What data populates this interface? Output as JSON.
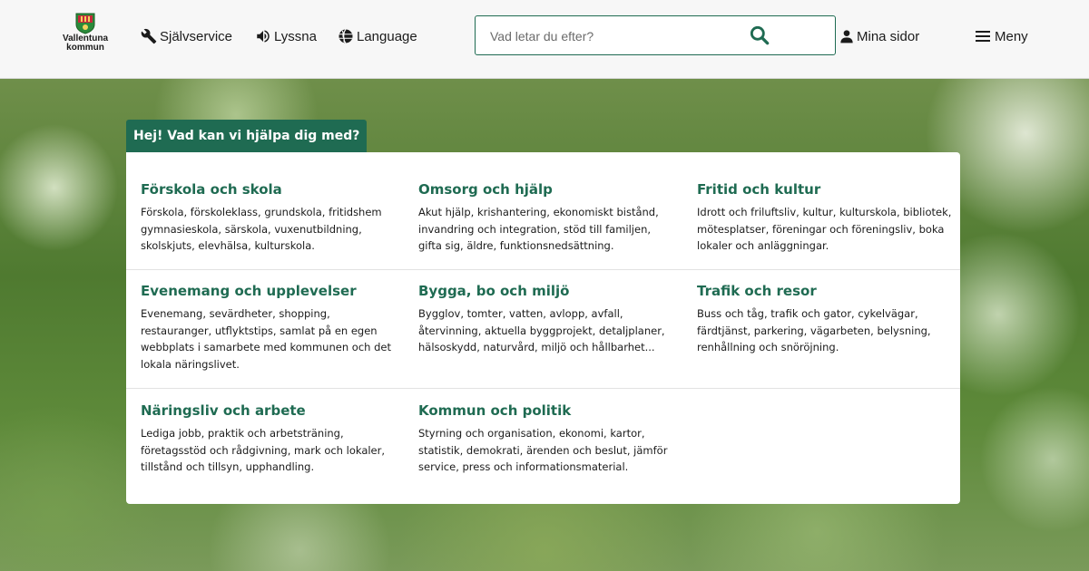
{
  "header": {
    "logo_text_line1": "Vallentuna",
    "logo_text_line2": "kommun",
    "selfservice_label": "Självservice",
    "listen_label": "Lyssna",
    "language_label": "Language",
    "search_placeholder": "Vad letar du efter?",
    "my_pages_label": "Mina sidor",
    "menu_label": "Meny",
    "icons": {
      "selfservice": "wrench-icon",
      "listen": "speaker-icon",
      "language": "globe-icon",
      "search": "search-icon",
      "my_pages": "user-icon",
      "menu": "hamburger-menu-icon"
    }
  },
  "main": {
    "greeting": "Hej! Vad kan vi hjälpa dig med?",
    "categories": [
      {
        "title": "Förskola och skola",
        "description": "Förskola, förskoleklass, grundskola, fritidshem gymnasieskola, särskola, vuxenutbildning, skolskjuts, elevhälsa, kulturskola."
      },
      {
        "title": "Omsorg och hjälp",
        "description": "Akut hjälp, krishantering, ekonomiskt bistånd, invandring och integration, stöd till familjen, gifta sig, äldre, funktionsnedsättning."
      },
      {
        "title": "Fritid och kultur",
        "description": "Idrott och friluftsliv, kultur, kulturskola, bibliotek, mötesplatser, föreningar och föreningsliv, boka lokaler och anläggningar."
      },
      {
        "title": "Evenemang och upplevelser",
        "description": "Evenemang, sevärdheter, shopping, restauranger, utflyktstips, samlat på en egen webbplats i samarbete med kommunen och det lokala näringslivet."
      },
      {
        "title": "Bygga, bo och miljö",
        "description": "Bygglov, tomter, vatten, avlopp, avfall, återvinning, aktuella byggprojekt, detaljplaner, hälsoskydd, naturvård, miljö och hållbarhet..."
      },
      {
        "title": "Trafik och resor",
        "description": "Buss och tåg, trafik och gator, cykelvägar, färdtjänst, parkering, vägarbeten, belysning, renhållning och snöröjning."
      },
      {
        "title": "Näringsliv och arbete",
        "description": "Lediga jobb, praktik och arbetsträning, företagsstöd och rådgivning, mark och lokaler, tillstånd och tillsyn, upphandling."
      },
      {
        "title": "Kommun och politik",
        "description": "Styrning och organisation, ekonomi, kartor, statistik, demokrati, ärenden och beslut, jämför service, press och informationsmaterial."
      }
    ]
  },
  "colors": {
    "brand_green": "#1f6b52",
    "header_bg": "#f7f7f7",
    "panel_bg": "#ffffff"
  }
}
